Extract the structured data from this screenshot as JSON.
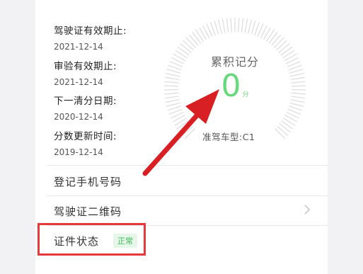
{
  "license_info": [
    {
      "label": "驾驶证有效期止:",
      "value": "2021-12-14"
    },
    {
      "label": "审验有效期止:",
      "value": "2021-12-14"
    },
    {
      "label": "下一清分日期:",
      "value": "2020-12-14"
    },
    {
      "label": "分数更新时间:",
      "value": "2019-12-14"
    }
  ],
  "score": {
    "title": "累积记分",
    "value": "0",
    "unit": "分",
    "vehicle_type": "准驾车型:C1"
  },
  "menu": {
    "register_phone": "登记手机号码",
    "license_qr": "驾驶证二维码",
    "cert_status": "证件状态",
    "cert_status_badge": "正常"
  },
  "colors": {
    "score_green": "#67d97a",
    "highlight_red": "#e5393c",
    "badge_bg": "#e6f7ea"
  }
}
